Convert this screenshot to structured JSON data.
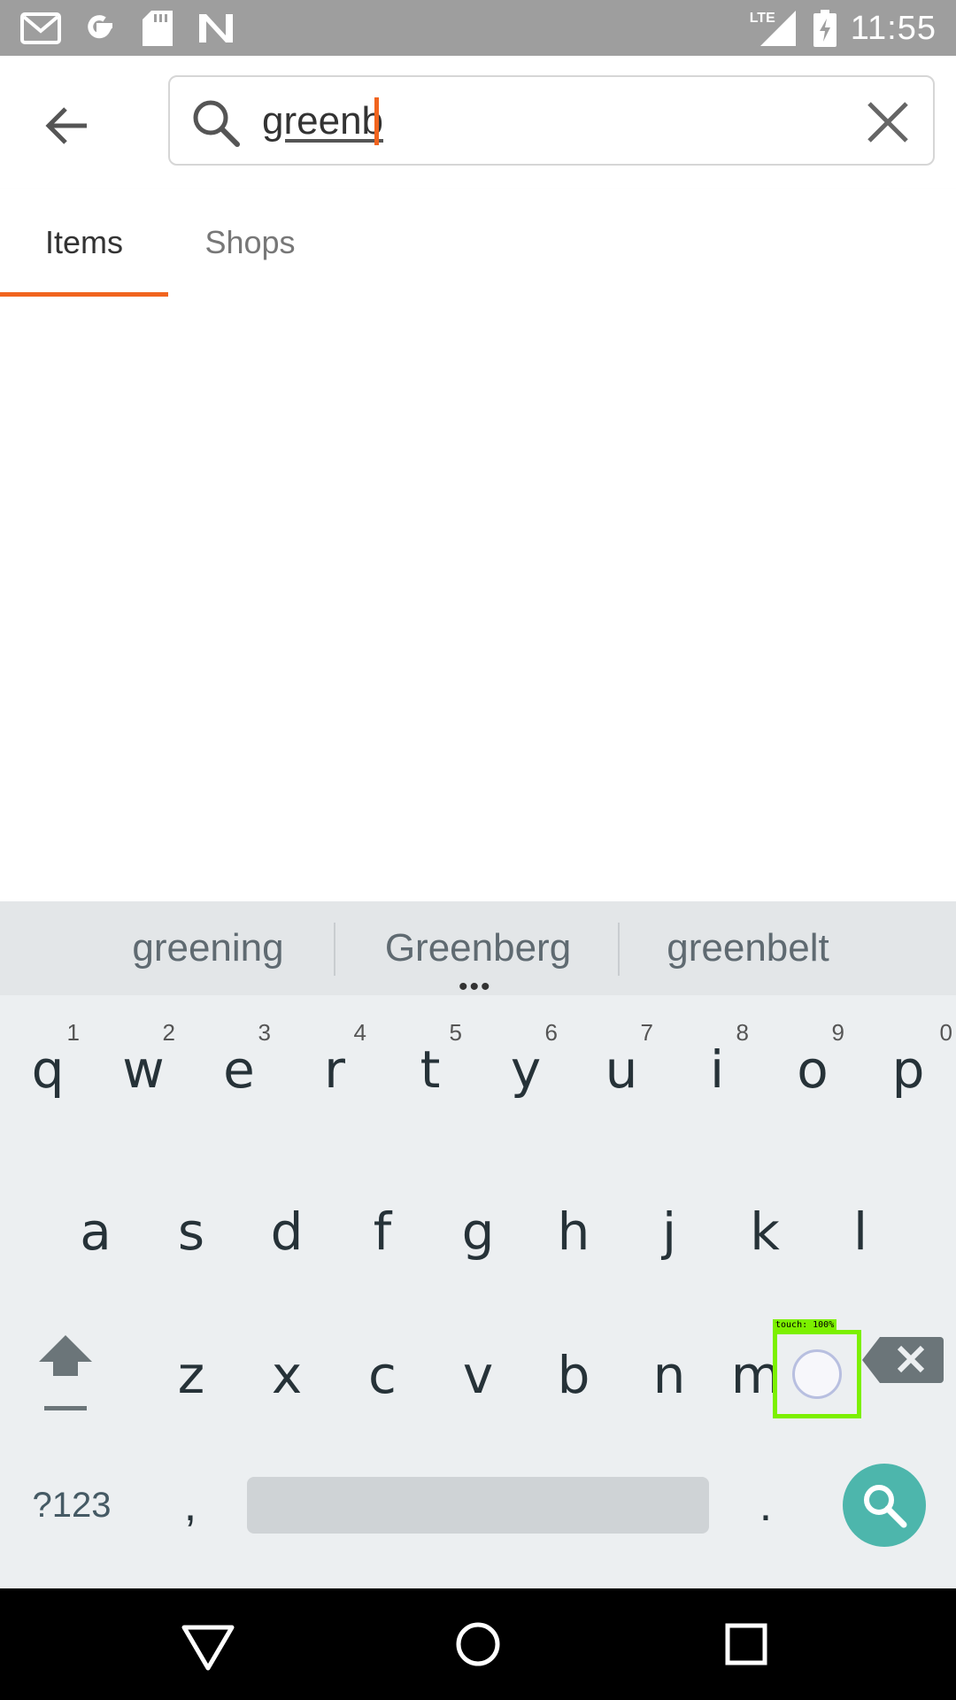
{
  "status_bar": {
    "time": "11:55",
    "network": "LTE",
    "icons": [
      "gmail-icon",
      "google-icon",
      "sd-card-icon",
      "n-icon",
      "signal-icon",
      "battery-charging-icon"
    ]
  },
  "search": {
    "query": "greenb",
    "icon": "search-icon",
    "clear_icon": "close-icon"
  },
  "tabs": [
    {
      "label": "Items",
      "selected": true
    },
    {
      "label": "Shops",
      "selected": false
    }
  ],
  "colors": {
    "accent": "#f1641e",
    "keyboard_bg": "#eceff1",
    "search_action": "#4db6ac",
    "status_bar": "#9e9e9e"
  },
  "keyboard": {
    "suggestions": [
      "greening",
      "Greenberg",
      "greenbelt"
    ],
    "row1": [
      {
        "key": "q",
        "hint": "1"
      },
      {
        "key": "w",
        "hint": "2"
      },
      {
        "key": "e",
        "hint": "3"
      },
      {
        "key": "r",
        "hint": "4"
      },
      {
        "key": "t",
        "hint": "5"
      },
      {
        "key": "y",
        "hint": "6"
      },
      {
        "key": "u",
        "hint": "7"
      },
      {
        "key": "i",
        "hint": "8"
      },
      {
        "key": "o",
        "hint": "9"
      },
      {
        "key": "p",
        "hint": "0"
      }
    ],
    "row2": [
      "a",
      "s",
      "d",
      "f",
      "g",
      "h",
      "j",
      "k",
      "l"
    ],
    "row3": [
      "z",
      "x",
      "c",
      "v",
      "b",
      "n",
      "m"
    ],
    "symbols_label": "?123",
    "comma": ",",
    "period": "."
  },
  "touch_overlay": {
    "label": "touch: 100%"
  }
}
